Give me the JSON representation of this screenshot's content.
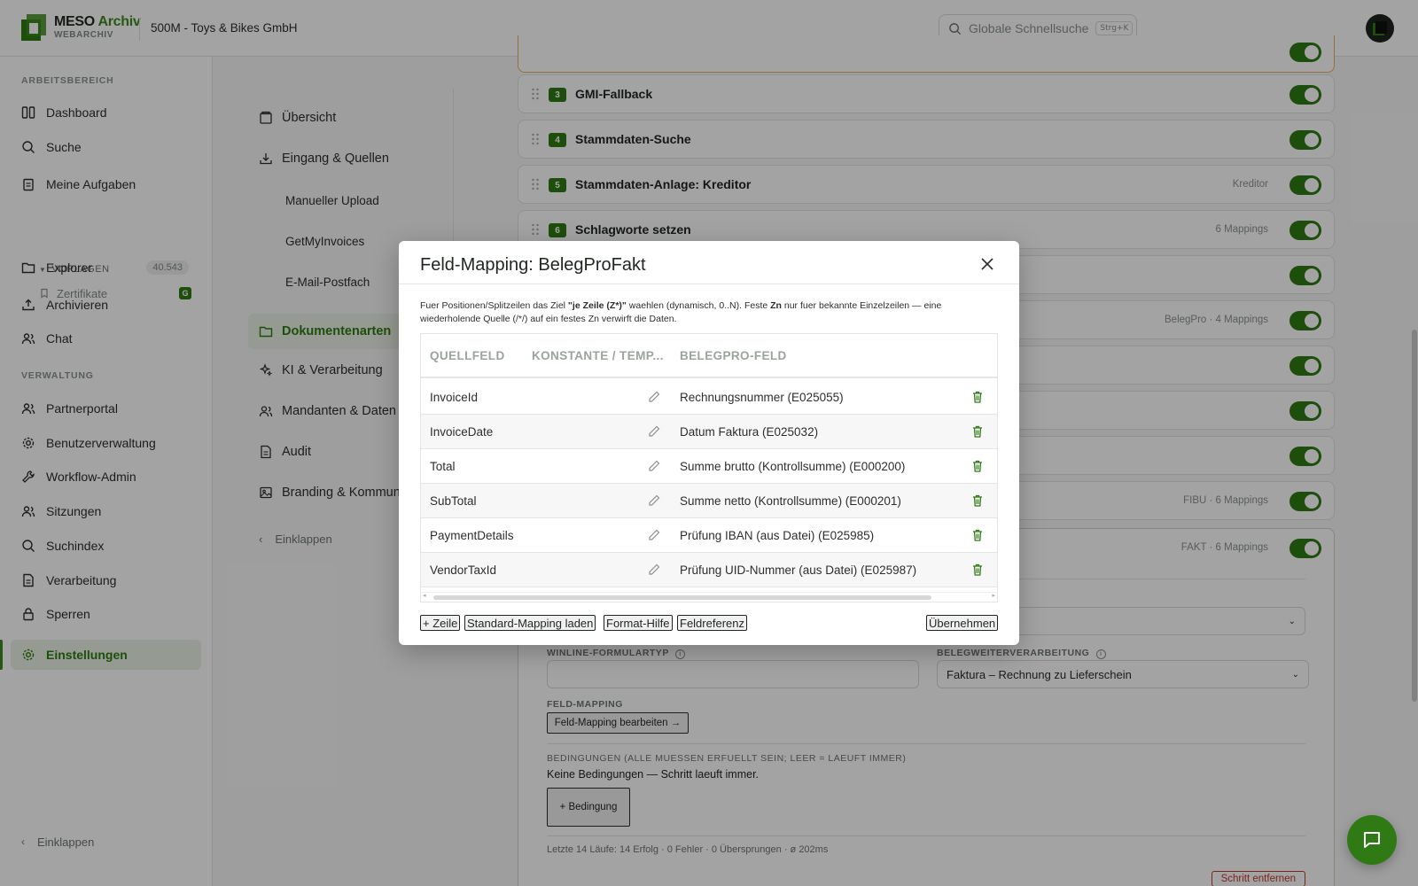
{
  "header": {
    "brand_main": "MESO ",
    "brand_accent": "Archiv",
    "brand_sub": "WEBARCHIV",
    "tenant": "500M - Toys & Bikes GmbH",
    "search_placeholder": "Globale Schnellsuche",
    "search_shortcut": "Strg+K"
  },
  "sidebar": {
    "section_work": "ARBEITSBEREICH",
    "section_admin": "VERWALTUNG",
    "items": {
      "dashboard": "Dashboard",
      "suche": "Suche",
      "aufgaben": "Meine Aufgaben",
      "explorer": "Explorer",
      "explorer_count": "40.543",
      "archivieren": "Archivieren",
      "chat": "Chat",
      "partnerportal": "Partnerportal",
      "benutzer": "Benutzerverwaltung",
      "workflow": "Workflow-Admin",
      "sitzungen": "Sitzungen",
      "suchindex": "Suchindex",
      "verarbeitung": "Verarbeitung",
      "sperren": "Sperren",
      "einstellungen": "Einstellungen"
    },
    "vorlagen": "VORLAGEN",
    "vorlagen_count": "1",
    "zertifikate": "Zertifikate",
    "zertifikate_badge": "G",
    "collapse": "Einklappen"
  },
  "settings_nav": {
    "uebersicht": "Übersicht",
    "eingang": "Eingang & Quellen",
    "upload": "Manueller Upload",
    "getmyinvoices": "GetMyInvoices",
    "mail": "E-Mail-Postfach",
    "dokumentenarten": "Dokumentenarten",
    "ki": "KI & Verarbeitung",
    "mandanten": "Mandanten & Daten",
    "audit": "Audit",
    "branding": "Branding & Kommunikation",
    "collapse": "Einklappen"
  },
  "steps": [
    {
      "num": "3",
      "title": "GMI-Fallback",
      "meta": ""
    },
    {
      "num": "4",
      "title": "Stammdaten-Suche",
      "meta": ""
    },
    {
      "num": "5",
      "title": "Stammdaten-Anlage: Kreditor",
      "meta": "Kreditor"
    },
    {
      "num": "6",
      "title": "Schlagworte setzen",
      "meta": "6 Mappings"
    },
    {
      "num": "",
      "title": "",
      "meta": ""
    },
    {
      "num": "",
      "title": "",
      "meta": "BelegPro · 4 Mappings"
    },
    {
      "num": "",
      "title": "",
      "meta": ""
    },
    {
      "num": "",
      "title": "",
      "meta": ""
    },
    {
      "num": "",
      "title": "",
      "meta": ""
    },
    {
      "num": "",
      "title": "",
      "meta": "FIBU · 6 Mappings"
    },
    {
      "num": "",
      "title": "",
      "meta": "FAKT · 6 Mappings"
    }
  ],
  "step_detail": {
    "winline_label": "WINLINE-FORMULARTYP",
    "weiter_label": "BELEGWEITERVERARBEITUNG",
    "weiter_value": "Faktura – Rechnung zu Lieferschein",
    "mapping_label": "FELD-MAPPING",
    "mapping_button": "Feld-Mapping bearbeiten →",
    "cond_label": "BEDINGUNGEN (ALLE MUESSEN ERFUELLT SEIN; LEER = LAEUFT IMMER)",
    "cond_text": "Keine Bedingungen — Schritt laeuft immer.",
    "cond_button": "+ Bedingung",
    "stats": "Letzte 14 Läufe: 14 Erfolg · 0 Fehler · 0 Übersprungen · ø 202ms",
    "remove_button": "Schritt entfernen"
  },
  "modal": {
    "title": "Feld-Mapping: BelegProFakt",
    "hint_1": "Fuer Positionen/Splitzeilen das Ziel ",
    "hint_bold_1": "\"je Zeile (Z*)\"",
    "hint_2": " waehlen (dynamisch, 0..N). Feste ",
    "hint_bold_2": "Zn",
    "hint_3": " nur fuer bekannte Einzelzeilen — eine wiederholende Quelle (/*/) auf ein festes Zn verwirft die Daten.",
    "columns": [
      "QUELLFELD",
      "KONSTANTE / TEMP...",
      "BELEGPRO-FELD"
    ],
    "rows": [
      {
        "source": "InvoiceId",
        "target": "Rechnungsnummer (E025055)"
      },
      {
        "source": "InvoiceDate",
        "target": "Datum Faktura (E025032)"
      },
      {
        "source": "Total",
        "target": "Summe brutto (Kontrollsumme) (E000200)"
      },
      {
        "source": "SubTotal",
        "target": "Summe netto (Kontrollsumme) (E000201)"
      },
      {
        "source": "PaymentDetails",
        "target": "Prüfung IBAN (aus Datei) (E025985)"
      },
      {
        "source": "VendorTaxId",
        "target": "Prüfung UID-Nummer (aus Datei) (E025987)"
      }
    ],
    "buttons": {
      "add_row": "+ Zeile",
      "load_default": "Standard-Mapping laden",
      "format_help": "Format-Hilfe",
      "field_ref": "Feldreferenz",
      "apply": "Übernehmen"
    }
  },
  "colors": {
    "accent": "#2f7a14",
    "accent_bg": "#e9f1e4",
    "danger": "#c0392b"
  }
}
